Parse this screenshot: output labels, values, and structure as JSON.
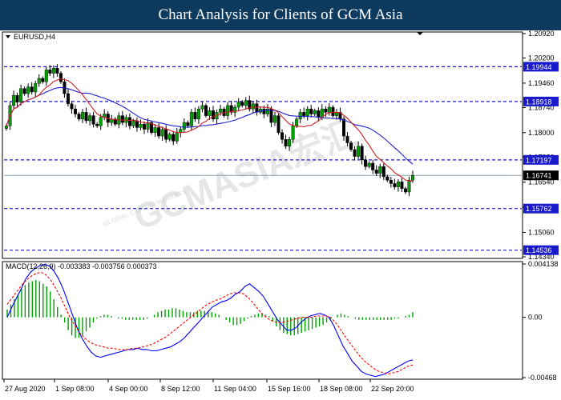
{
  "header": {
    "title": "Chart Analysis for Clients of GCM Asia"
  },
  "watermark": {
    "main": "GCMASIA宏汇",
    "sub": "GLOBAL CAPITAL MARKETS"
  },
  "chart_data": [
    {
      "type": "candlestick",
      "title": "EURUSD,H4",
      "y_ticks": [
        "1.20920",
        "1.20200",
        "1.19460",
        "1.18740",
        "1.18000",
        "1.17280",
        "1.16540",
        "1.15800",
        "1.15060",
        "1.14340"
      ],
      "ylim": [
        1.1434,
        1.2092
      ],
      "levels": [
        {
          "value": 1.19944,
          "label": "1.19944"
        },
        {
          "value": 1.18918,
          "label": "1.18918"
        },
        {
          "value": 1.17197,
          "label": "1.17197"
        },
        {
          "value": 1.15762,
          "label": "1.15762"
        },
        {
          "value": 1.14536,
          "label": "1.14536"
        }
      ],
      "current_price": {
        "value": 1.16741,
        "label": "1.16741"
      },
      "level_color": "#1a1acd",
      "up_color": "#00a000",
      "down_color": "#000000",
      "ma_fast_color": "#d02020",
      "ma_slow_color": "#2020d0",
      "closes": [
        1.182,
        1.188,
        1.191,
        1.189,
        1.193,
        1.1915,
        1.1935,
        1.192,
        1.1945,
        1.196,
        1.195,
        1.1985,
        1.1975,
        1.199,
        1.1975,
        1.195,
        1.1915,
        1.1885,
        1.187,
        1.1855,
        1.184,
        1.186,
        1.1835,
        1.185,
        1.1825,
        1.182,
        1.1845,
        1.1855,
        1.183,
        1.184,
        1.1825,
        1.185,
        1.183,
        1.1845,
        1.182,
        1.1835,
        1.1815,
        1.1825,
        1.181,
        1.183,
        1.18,
        1.1815,
        1.179,
        1.181,
        1.178,
        1.1795,
        1.1775,
        1.18,
        1.181,
        1.183,
        1.182,
        1.186,
        1.184,
        1.187,
        1.188,
        1.185,
        1.1865,
        1.184,
        1.186,
        1.187,
        1.185,
        1.188,
        1.186,
        1.1875,
        1.189,
        1.188,
        1.1895,
        1.187,
        1.1885,
        1.186,
        1.187,
        1.1855,
        1.187,
        1.183,
        1.185,
        1.18,
        1.178,
        1.176,
        1.178,
        1.182,
        1.184,
        1.186,
        1.185,
        1.187,
        1.1855,
        1.1865,
        1.1845,
        1.187,
        1.186,
        1.1875,
        1.185,
        1.186,
        1.184,
        1.179,
        1.177,
        1.175,
        1.173,
        1.176,
        1.172,
        1.17,
        1.171,
        1.169,
        1.168,
        1.17,
        1.167,
        1.166,
        1.165,
        1.164,
        1.1655,
        1.1635,
        1.1625,
        1.166,
        1.1674
      ]
    },
    {
      "type": "macd",
      "title": "MACD(12,26,9) -0.003383 -0.003756 0.000373",
      "y_ticks": [
        "0.004138",
        "0.00",
        "-0.00468"
      ],
      "ylim": [
        -0.00468,
        0.004138
      ],
      "histogram_color": "#00a000",
      "main_color": "#0000ff",
      "signal_color": "#ff0000",
      "histogram": [
        0.0006,
        0.001,
        0.0014,
        0.0018,
        0.0022,
        0.0025,
        0.0027,
        0.0028,
        0.0029,
        0.0028,
        0.0026,
        0.0024,
        0.002,
        0.0014,
        0.0008,
        0.0002,
        -0.0004,
        -0.001,
        -0.0014,
        -0.0016,
        -0.0016,
        -0.0014,
        -0.0011,
        -0.0008,
        -0.0004,
        -0.0001,
        0.0001,
        0.0002,
        0.0002,
        0.0001,
        0.0,
        -0.0001,
        -0.0001,
        -0.0002,
        -0.0002,
        -0.0002,
        -0.0002,
        -0.0002,
        -0.0002,
        -0.0001,
        0.0,
        0.0002,
        0.0004,
        0.0005,
        0.0006,
        0.0006,
        0.0007,
        0.0007,
        0.0006,
        0.0005,
        0.0004,
        0.0004,
        0.0004,
        0.0005,
        0.0005,
        0.0005,
        0.0005,
        0.0004,
        0.0003,
        0.0002,
        0.0,
        -0.0002,
        -0.0004,
        -0.0006,
        -0.0006,
        -0.0005,
        -0.0003,
        -0.0001,
        0.0001,
        0.0002,
        0.0003,
        0.0003,
        0.0002,
        0.0001,
        -0.0003,
        -0.0007,
        -0.001,
        -0.0012,
        -0.0013,
        -0.0014,
        -0.0014,
        -0.0013,
        -0.0012,
        -0.0011,
        -0.001,
        -0.0009,
        -0.0008,
        -0.0007,
        -0.0006,
        -0.0004,
        -0.0002,
        0.0,
        0.0002,
        0.0003,
        0.0002,
        0.0001,
        0.0,
        -0.0001,
        -0.0002,
        -0.0002,
        -0.0002,
        -0.0002,
        -0.0002,
        -0.0002,
        -0.0002,
        -0.0002,
        -0.0002,
        -0.0002,
        -0.0001,
        -0.0001,
        0.0,
        0.0001,
        0.0002,
        0.0004
      ],
      "main": [
        0.0,
        0.0008,
        0.0015,
        0.0022,
        0.003,
        0.0035,
        0.0038,
        0.004,
        0.0041,
        0.004,
        0.0036,
        0.003,
        0.0022,
        0.0012,
        0.0002,
        -0.0008,
        -0.0016,
        -0.0022,
        -0.0027,
        -0.003,
        -0.0031,
        -0.003,
        -0.0029,
        -0.0028,
        -0.0027,
        -0.0026,
        -0.0025,
        -0.0025,
        -0.0024,
        -0.0025,
        -0.0025,
        -0.0026,
        -0.0026,
        -0.0025,
        -0.0024,
        -0.0023,
        -0.0021,
        -0.0019,
        -0.0016,
        -0.0012,
        -0.0008,
        -0.0004,
        0.0,
        0.0004,
        0.0008,
        0.001,
        0.0012,
        0.0013,
        0.0015,
        0.0018,
        0.002,
        0.0024,
        0.0026,
        0.0023,
        0.002,
        0.0016,
        0.001,
        0.0004,
        -0.0002,
        -0.0006,
        -0.001,
        -0.001,
        -0.0008,
        -0.0004,
        -0.0001,
        0.0001,
        0.0002,
        0.0003,
        0.0002,
        0.0,
        -0.0006,
        -0.0014,
        -0.0022,
        -0.0028,
        -0.0034,
        -0.0038,
        -0.0042,
        -0.0044,
        -0.0045,
        -0.0046,
        -0.0045,
        -0.0044,
        -0.0042,
        -0.004,
        -0.0038,
        -0.0036,
        -0.0034,
        -0.0033
      ],
      "signal": [
        0.001,
        0.0015,
        0.002,
        0.0025,
        0.0029,
        0.0032,
        0.0034,
        0.0035,
        0.0033,
        0.0029,
        0.0023,
        0.0016,
        0.0008,
        0.0,
        -0.0006,
        -0.0012,
        -0.0016,
        -0.0019,
        -0.0021,
        -0.0022,
        -0.0023,
        -0.0024,
        -0.0024,
        -0.0025,
        -0.0025,
        -0.0025,
        -0.0024,
        -0.0024,
        -0.0023,
        -0.0022,
        -0.0021,
        -0.0019,
        -0.0017,
        -0.0015,
        -0.0012,
        -0.0009,
        -0.0006,
        -0.0003,
        0.0,
        0.0003,
        0.0006,
        0.0009,
        0.0011,
        0.0013,
        0.0014,
        0.0016,
        0.0018,
        0.0019,
        0.0019,
        0.0018,
        0.0015,
        0.0011,
        0.0006,
        0.0002,
        -0.0001,
        -0.0003,
        -0.0004,
        -0.0004,
        -0.0003,
        -0.0002,
        -0.0001,
        0.0,
        0.0,
        0.0,
        0.0001,
        0.0001,
        0.0001,
        0.0,
        -0.0004,
        -0.0009,
        -0.0015,
        -0.002,
        -0.0025,
        -0.003,
        -0.0034,
        -0.0037,
        -0.004,
        -0.0042,
        -0.0043,
        -0.0044,
        -0.0043,
        -0.0042,
        -0.004,
        -0.0038,
        -0.0037
      ]
    }
  ],
  "x_axis_labels": [
    "27 Aug 2020",
    "1 Sep 08:00",
    "4 Sep 00:00",
    "8 Sep 12:00",
    "11 Sep 04:00",
    "15 Sep 16:00",
    "18 Sep 08:00",
    "22 Sep 20:00"
  ]
}
